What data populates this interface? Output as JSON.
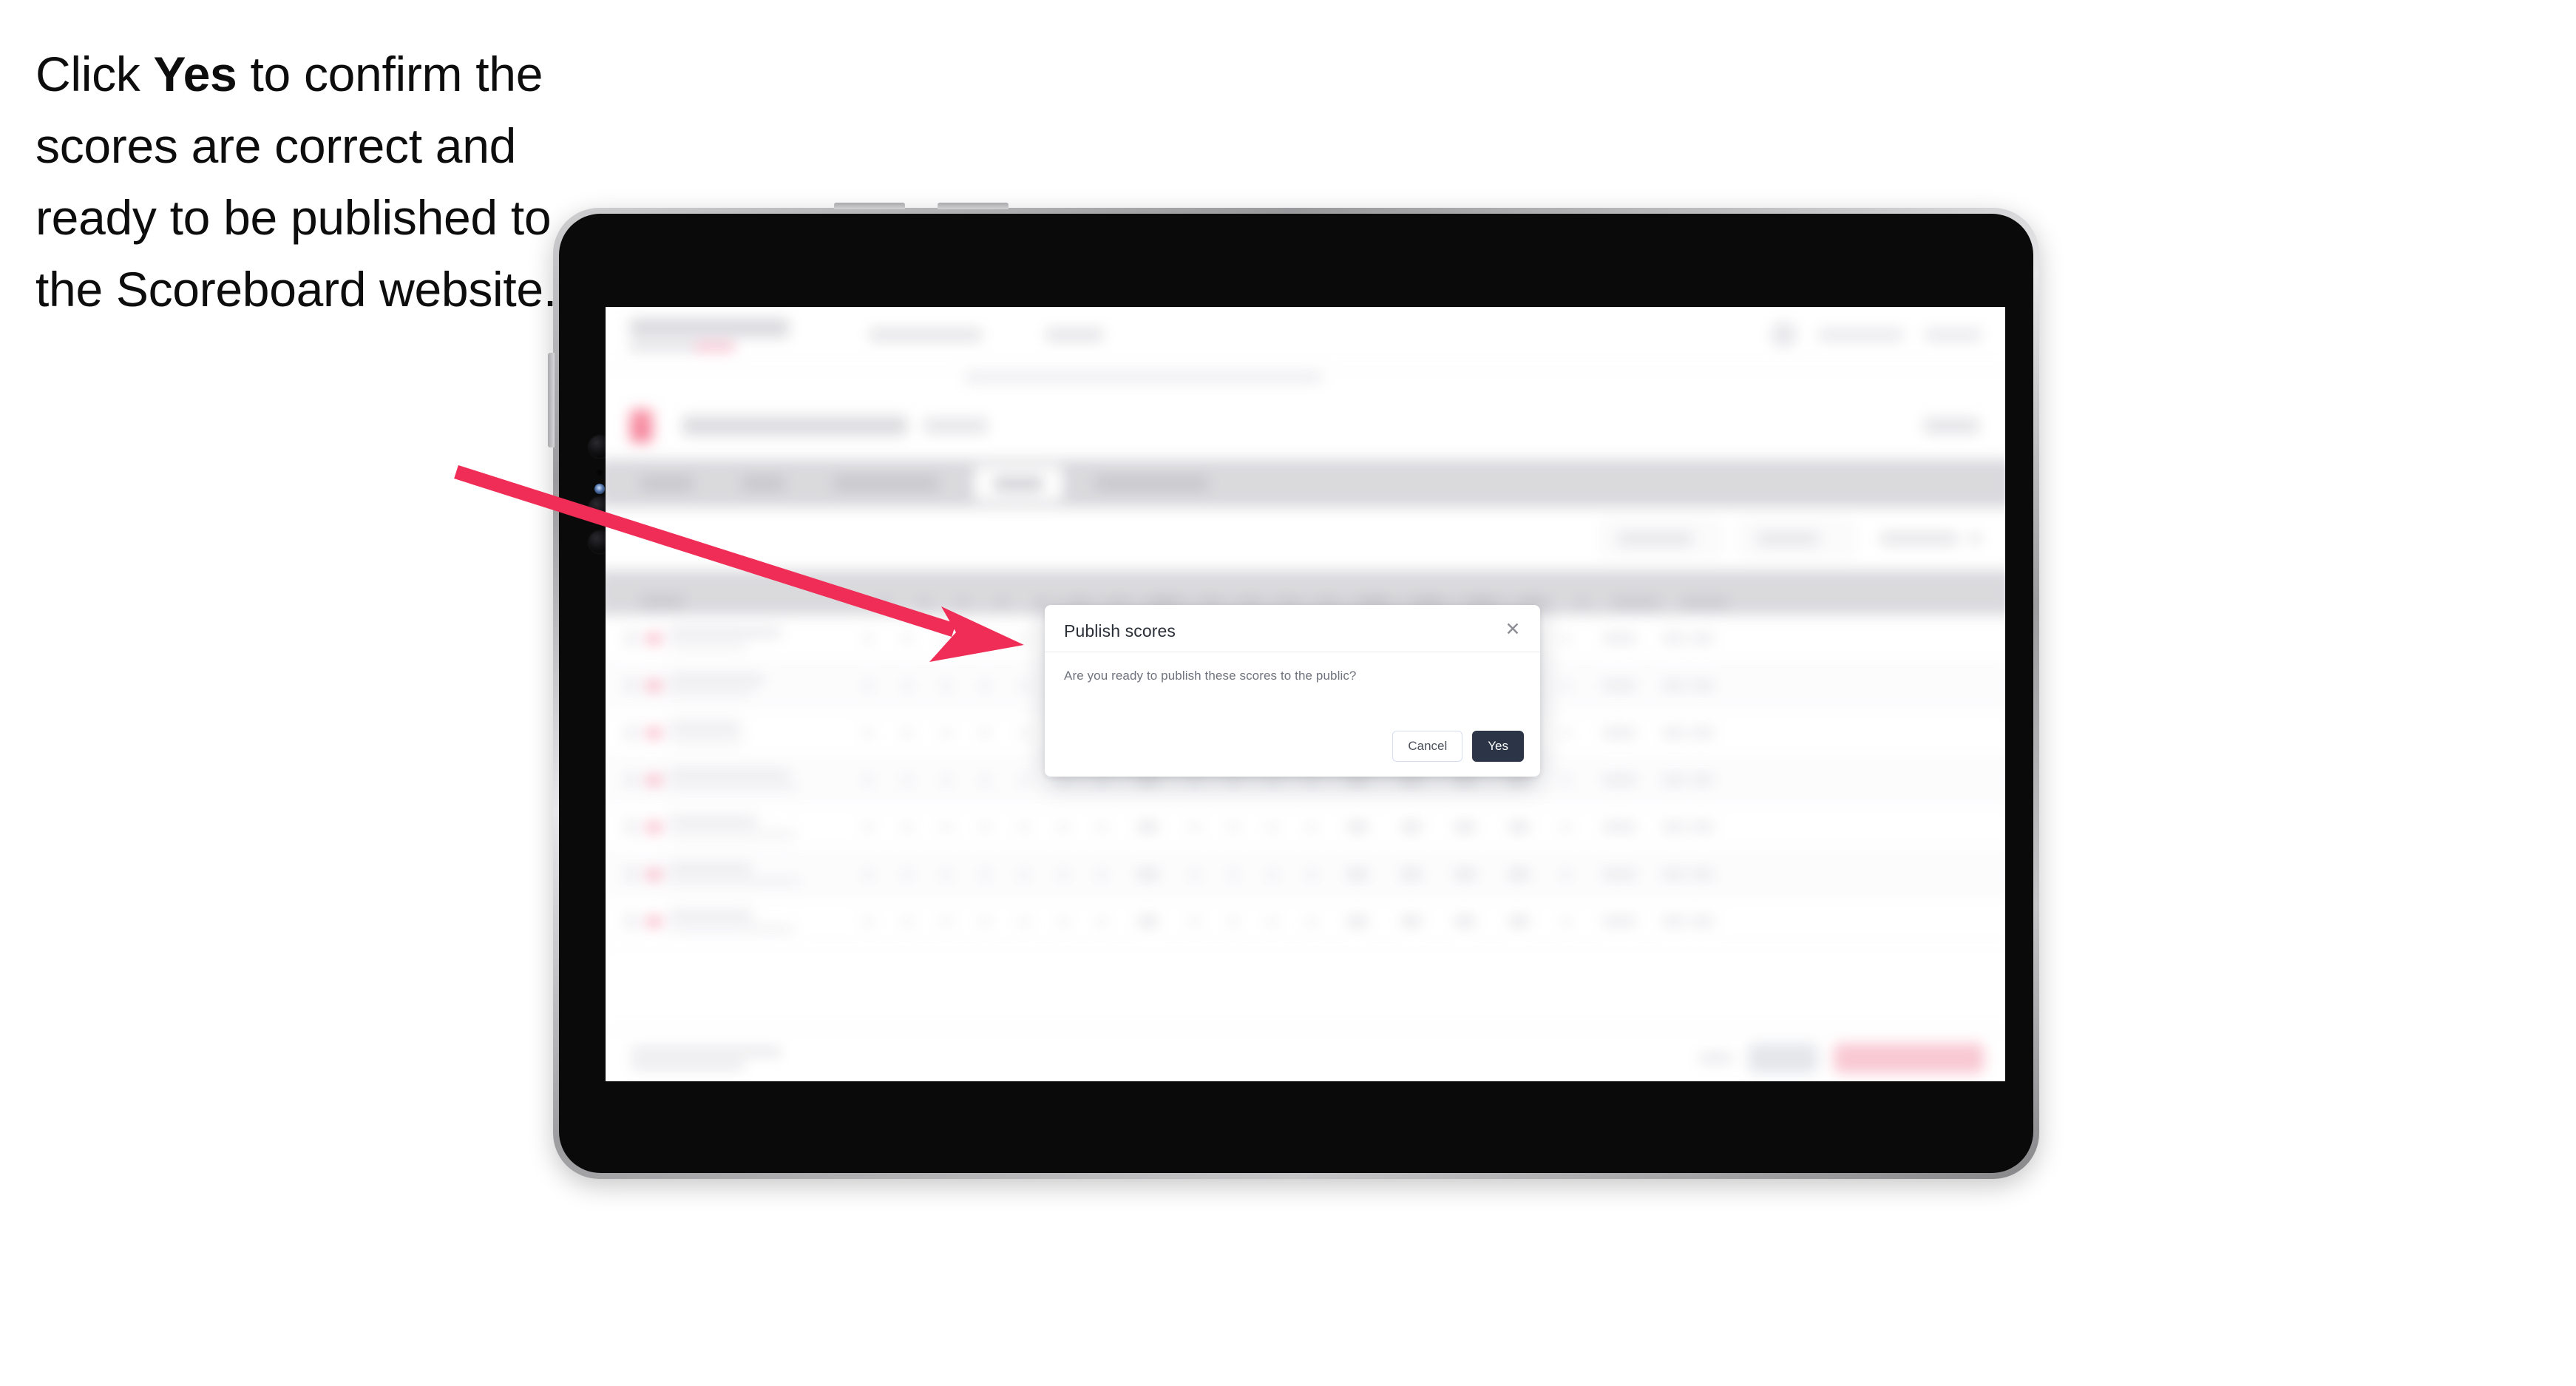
{
  "instruction": {
    "part1": "Click ",
    "emphasis": "Yes",
    "part2": " to confirm the scores are correct and ready to be published to the Scoreboard website."
  },
  "annotation": {
    "arrow_color": "#ef2d56",
    "arrow_name": "pointer-arrow",
    "points_to": "Publish scores dialog"
  },
  "device": {
    "type": "tablet",
    "frame_color": "#0a0a0a",
    "bezel_color": "#b8b8bb"
  },
  "modal": {
    "title": "Publish scores",
    "message": "Are you ready to publish these scores to the public?",
    "close_label": "✕",
    "cancel_label": "Cancel",
    "confirm_label": "Yes",
    "confirm_bg": "#2c3547",
    "confirm_fg": "#ffffff",
    "cancel_border": "#d6def0"
  },
  "background_app": {
    "state": "blurred",
    "description": "Scoreboard results table behind modal",
    "accent_color": "#ee2e56",
    "tabs_count": 5,
    "active_tab_index": 3,
    "table_rows": 7,
    "score_columns": 13
  }
}
